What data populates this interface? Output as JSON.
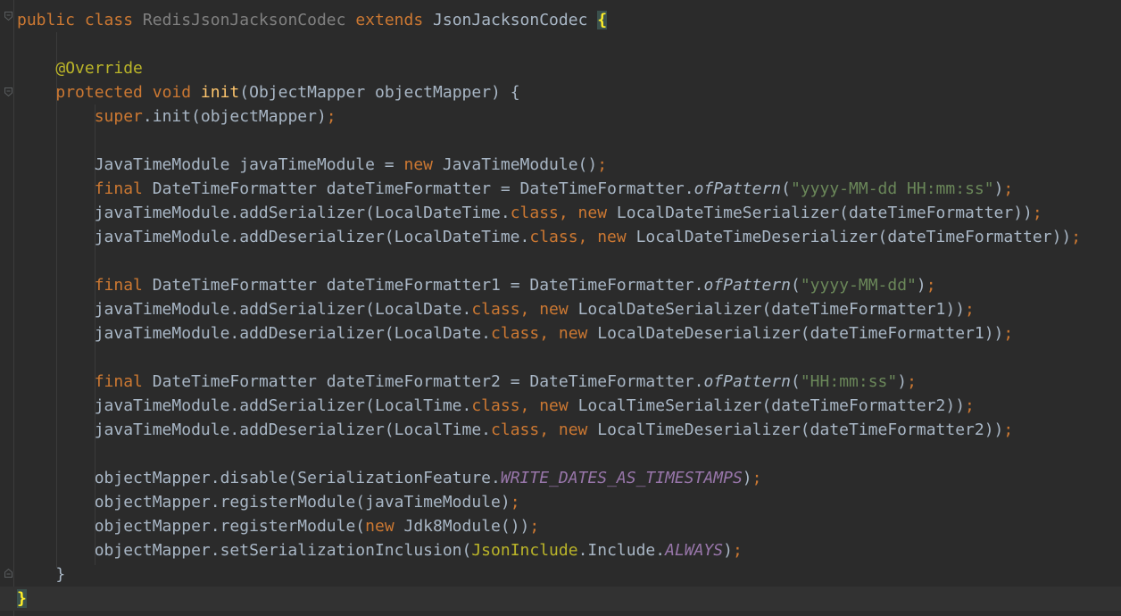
{
  "editor": {
    "language": "Java",
    "theme_colors": {
      "background": "#2b2b2b",
      "default_text": "#a9b7c6",
      "keyword": "#cc7832",
      "string": "#6a8759",
      "annotation": "#bbb529",
      "method_declaration": "#ffc66d",
      "static_field": "#9876aa",
      "unused_class_name": "#808080"
    },
    "lines": [
      [
        {
          "t": "public class ",
          "c": "kw"
        },
        {
          "t": "RedisJsonJacksonCodec ",
          "c": "unused"
        },
        {
          "t": "extends ",
          "c": "kw"
        },
        {
          "t": "JsonJacksonCodec "
        },
        {
          "t": "{",
          "c": "brace-match"
        }
      ],
      [],
      [
        {
          "t": "    "
        },
        {
          "t": "@Override",
          "c": "ann"
        }
      ],
      [
        {
          "t": "    "
        },
        {
          "t": "protected void ",
          "c": "kw"
        },
        {
          "t": "init",
          "c": "fn"
        },
        {
          "t": "(ObjectMapper objectMapper) {"
        }
      ],
      [
        {
          "t": "        "
        },
        {
          "t": "super",
          "c": "kw"
        },
        {
          "t": ".init(objectMapper)"
        },
        {
          "t": ";",
          "c": "kw"
        }
      ],
      [],
      [
        {
          "t": "        JavaTimeModule javaTimeModule = "
        },
        {
          "t": "new ",
          "c": "kw"
        },
        {
          "t": "JavaTimeModule()"
        },
        {
          "t": ";",
          "c": "kw"
        }
      ],
      [
        {
          "t": "        "
        },
        {
          "t": "final ",
          "c": "kw"
        },
        {
          "t": "DateTimeFormatter dateTimeFormatter = DateTimeFormatter."
        },
        {
          "t": "ofPattern",
          "c": "method-static"
        },
        {
          "t": "("
        },
        {
          "t": "\"yyyy-MM-dd HH:mm:ss\"",
          "c": "str"
        },
        {
          "t": ")"
        },
        {
          "t": ";",
          "c": "kw"
        }
      ],
      [
        {
          "t": "        javaTimeModule.addSerializer(LocalDateTime."
        },
        {
          "t": "class, new ",
          "c": "kw"
        },
        {
          "t": "LocalDateTimeSerializer(dateTimeFormatter))"
        },
        {
          "t": ";",
          "c": "kw"
        }
      ],
      [
        {
          "t": "        javaTimeModule.addDeserializer(LocalDateTime."
        },
        {
          "t": "class, new ",
          "c": "kw"
        },
        {
          "t": "LocalDateTimeDeserializer(dateTimeFormatter))"
        },
        {
          "t": ";",
          "c": "kw"
        }
      ],
      [],
      [
        {
          "t": "        "
        },
        {
          "t": "final ",
          "c": "kw"
        },
        {
          "t": "DateTimeFormatter dateTimeFormatter1 = DateTimeFormatter."
        },
        {
          "t": "ofPattern",
          "c": "method-static"
        },
        {
          "t": "("
        },
        {
          "t": "\"yyyy-MM-dd\"",
          "c": "str"
        },
        {
          "t": ")"
        },
        {
          "t": ";",
          "c": "kw"
        }
      ],
      [
        {
          "t": "        javaTimeModule.addSerializer(LocalDate."
        },
        {
          "t": "class, new ",
          "c": "kw"
        },
        {
          "t": "LocalDateSerializer(dateTimeFormatter1))"
        },
        {
          "t": ";",
          "c": "kw"
        }
      ],
      [
        {
          "t": "        javaTimeModule.addDeserializer(LocalDate."
        },
        {
          "t": "class, new ",
          "c": "kw"
        },
        {
          "t": "LocalDateDeserializer(dateTimeFormatter1))"
        },
        {
          "t": ";",
          "c": "kw"
        }
      ],
      [],
      [
        {
          "t": "        "
        },
        {
          "t": "final ",
          "c": "kw"
        },
        {
          "t": "DateTimeFormatter dateTimeFormatter2 = DateTimeFormatter."
        },
        {
          "t": "ofPattern",
          "c": "method-static"
        },
        {
          "t": "("
        },
        {
          "t": "\"HH:mm:ss\"",
          "c": "str"
        },
        {
          "t": ")"
        },
        {
          "t": ";",
          "c": "kw"
        }
      ],
      [
        {
          "t": "        javaTimeModule.addSerializer(LocalTime."
        },
        {
          "t": "class, new ",
          "c": "kw"
        },
        {
          "t": "LocalTimeSerializer(dateTimeFormatter2))"
        },
        {
          "t": ";",
          "c": "kw"
        }
      ],
      [
        {
          "t": "        javaTimeModule.addDeserializer(LocalTime."
        },
        {
          "t": "class, new ",
          "c": "kw"
        },
        {
          "t": "LocalTimeDeserializer(dateTimeFormatter2))"
        },
        {
          "t": ";",
          "c": "kw"
        }
      ],
      [],
      [
        {
          "t": "        objectMapper.disable(SerializationFeature."
        },
        {
          "t": "WRITE_DATES_AS_TIMESTAMPS",
          "c": "field"
        },
        {
          "t": ")"
        },
        {
          "t": ";",
          "c": "kw"
        }
      ],
      [
        {
          "t": "        objectMapper.registerModule(javaTimeModule)"
        },
        {
          "t": ";",
          "c": "kw"
        }
      ],
      [
        {
          "t": "        objectMapper.registerModule("
        },
        {
          "t": "new ",
          "c": "kw"
        },
        {
          "t": "Jdk8Module())"
        },
        {
          "t": ";",
          "c": "kw"
        }
      ],
      [
        {
          "t": "        objectMapper.setSerializationInclusion("
        },
        {
          "t": "JsonInclude",
          "c": "ann"
        },
        {
          "t": ".Include."
        },
        {
          "t": "ALWAYS",
          "c": "field"
        },
        {
          "t": ")"
        },
        {
          "t": ";",
          "c": "kw"
        }
      ],
      [
        {
          "t": "    }"
        }
      ],
      [
        {
          "t": "}",
          "c": "brace-match"
        }
      ]
    ]
  }
}
